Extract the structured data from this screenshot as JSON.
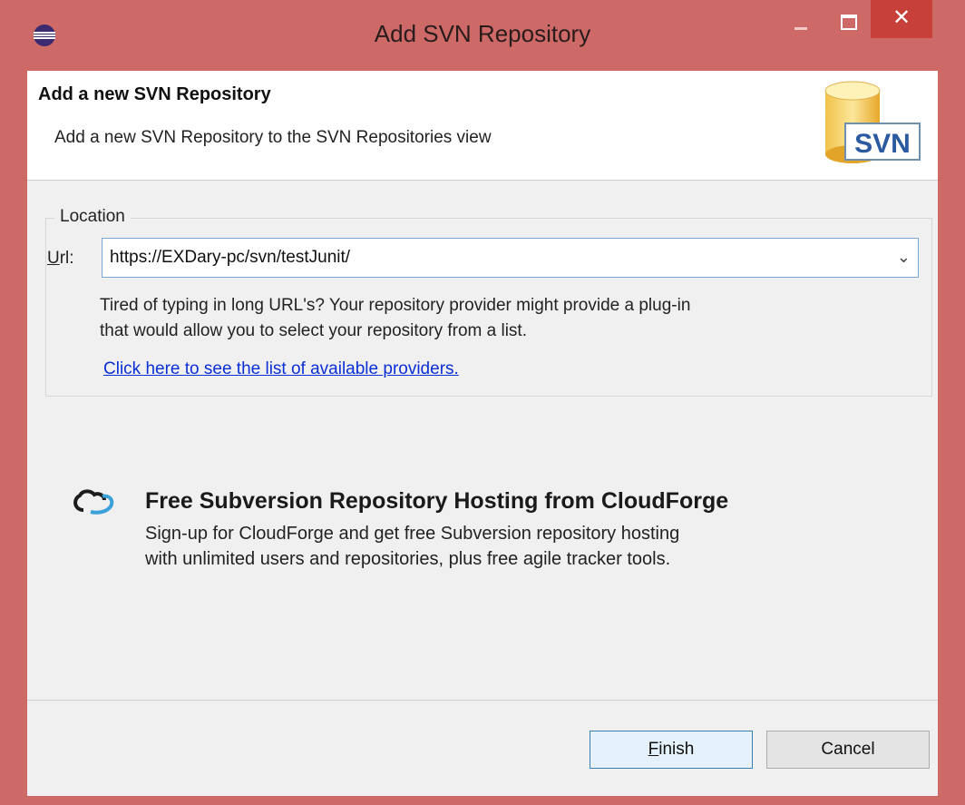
{
  "window": {
    "title": "Add SVN Repository",
    "close_glyph": "✕"
  },
  "header": {
    "title": "Add a new SVN Repository",
    "description": "Add a new SVN Repository to the SVN Repositories view",
    "logo_text": "SVN"
  },
  "location": {
    "group_label": "Location",
    "url_label_mnemonic": "U",
    "url_label_rest": "rl:",
    "url_value": "https://EXDary-pc/svn/testJunit/",
    "dropdown_glyph": "⌄",
    "help_line1": "Tired of typing in long URL's?  Your repository provider might provide a plug-in",
    "help_line2": "that would allow you to select your repository from a list.",
    "providers_link": "Click here to see the list of available providers."
  },
  "cloudforge": {
    "title": "Free Subversion Repository Hosting from CloudForge",
    "line1": "Sign-up for CloudForge and get free Subversion repository hosting",
    "line2": "with unlimited users and repositories, plus free agile tracker tools."
  },
  "buttons": {
    "finish_mnemonic": "F",
    "finish_rest": "inish",
    "cancel": "Cancel"
  },
  "colors": {
    "frame": "#cd6a67",
    "close_button": "#c7403a",
    "link": "#0b2fd6",
    "focus_border": "#3c7fb1"
  }
}
